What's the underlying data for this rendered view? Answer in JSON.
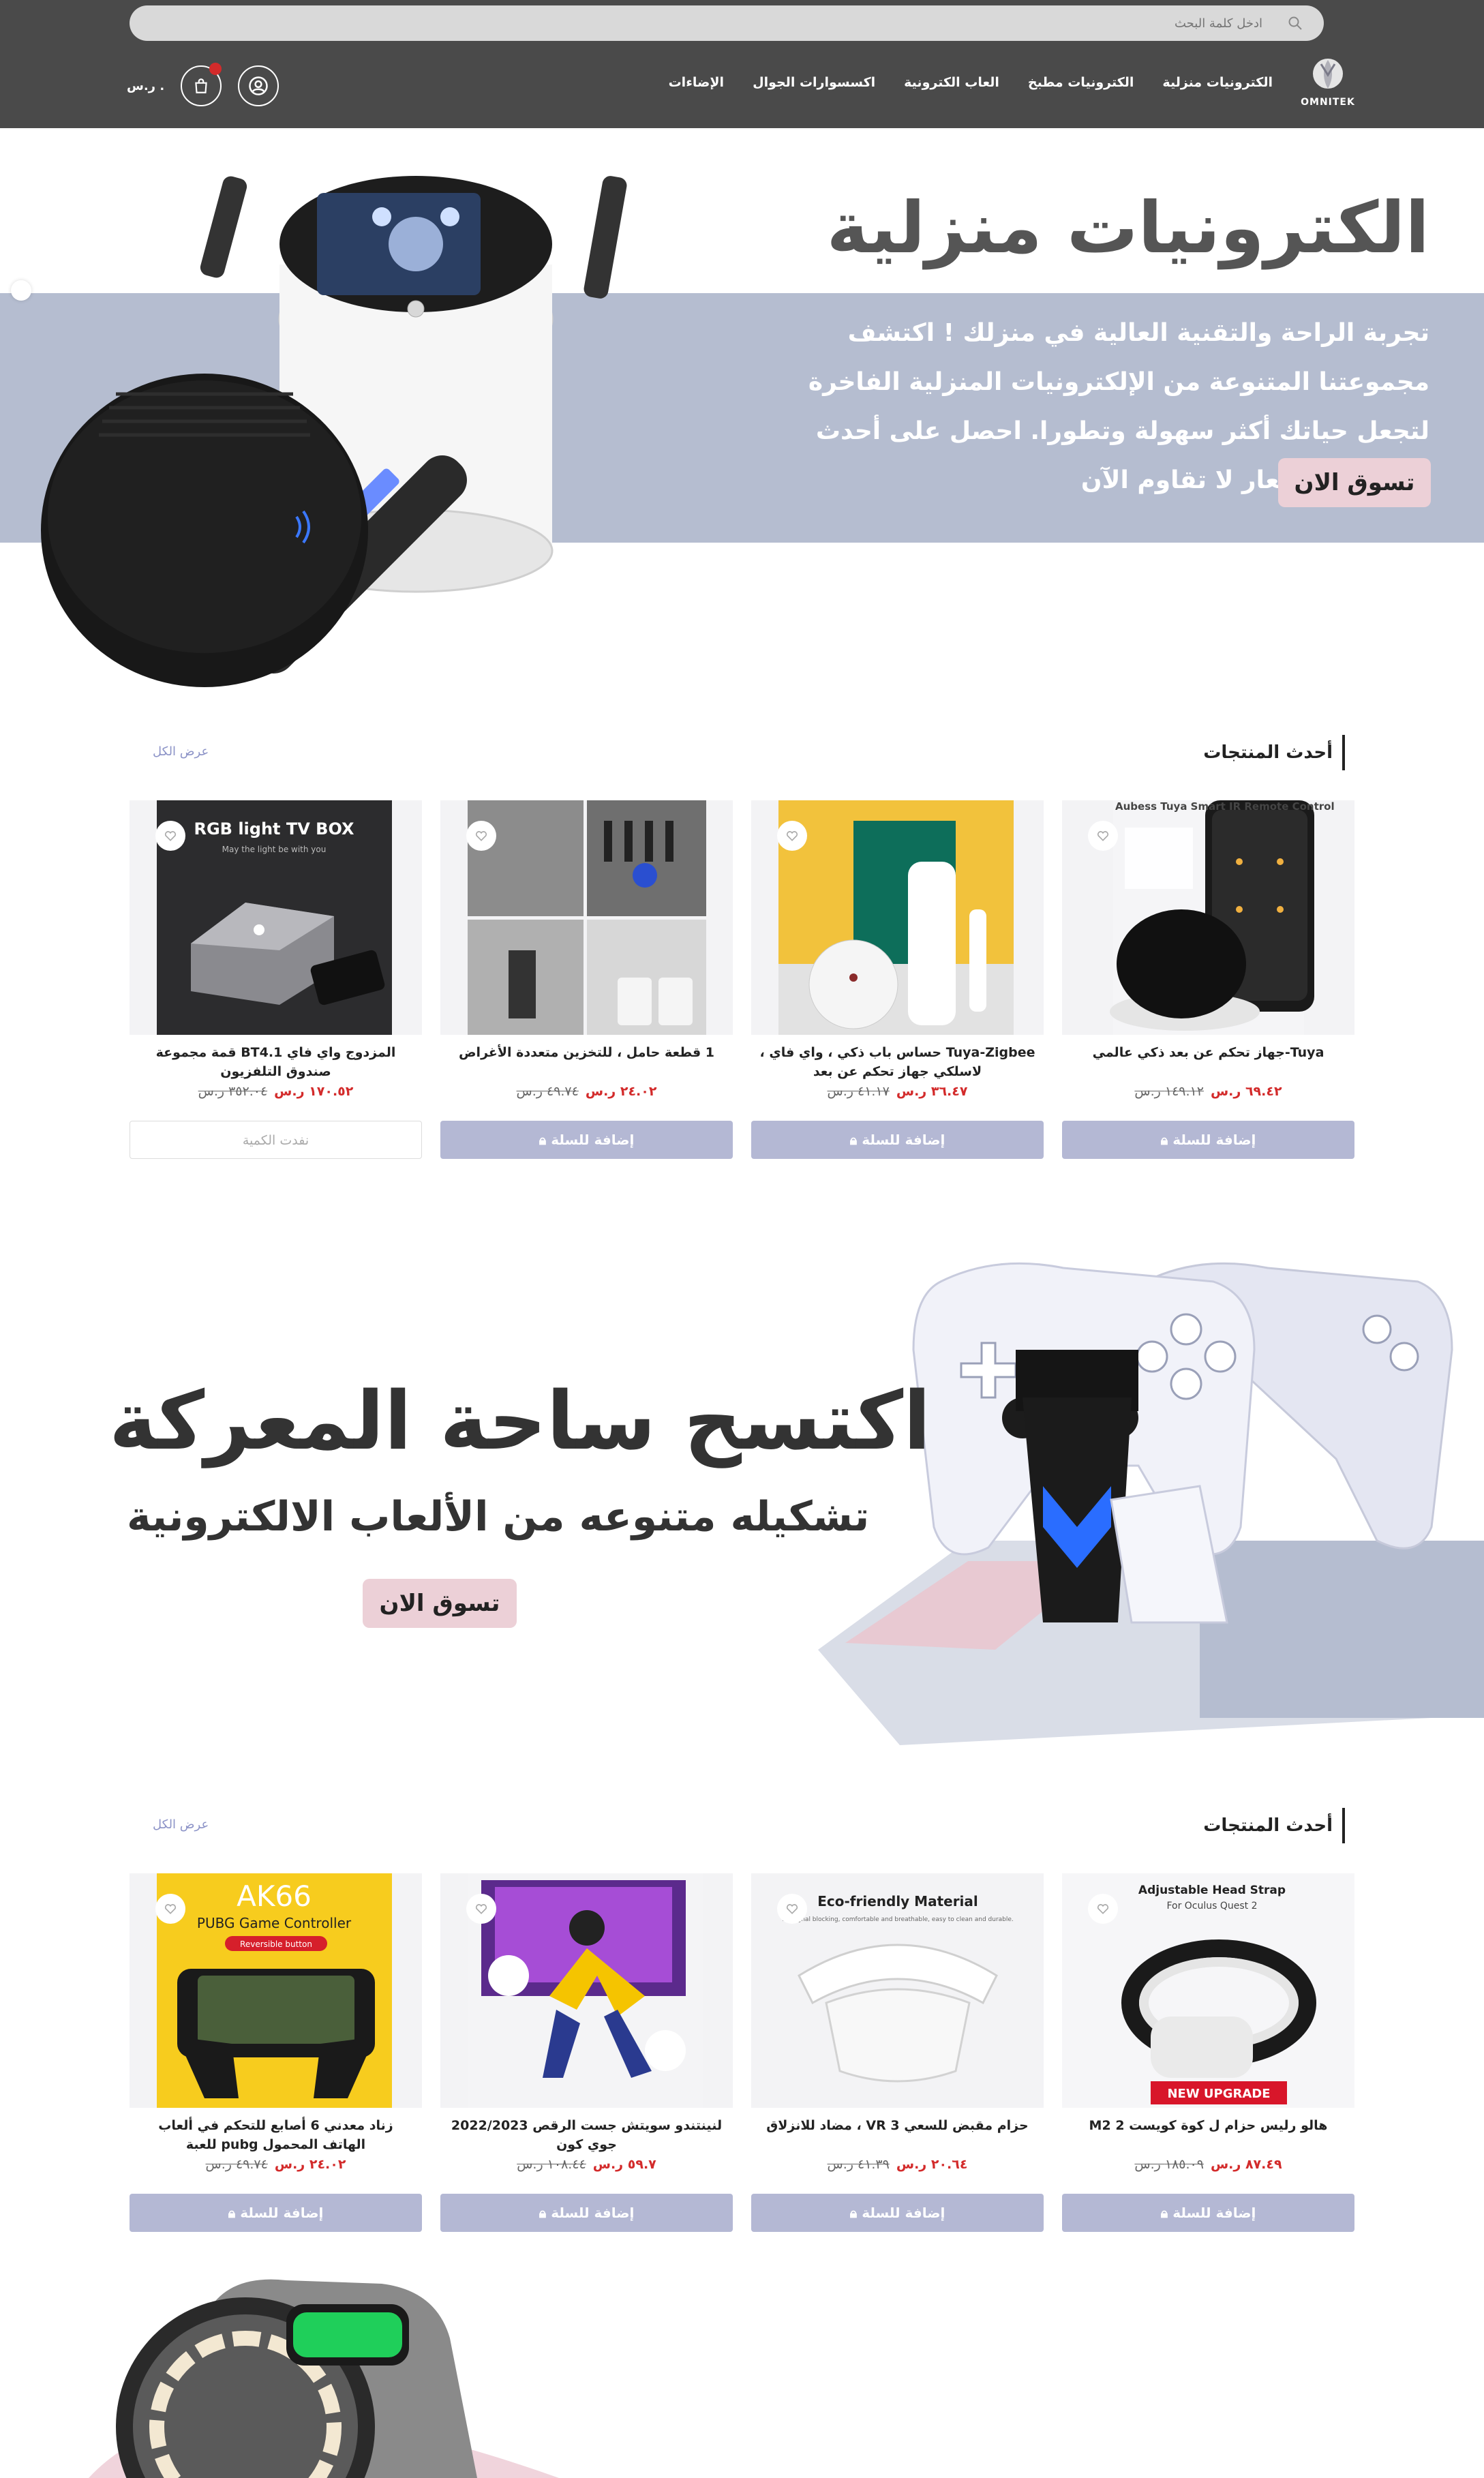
{
  "header": {
    "search_placeholder": "ادخل كلمة البحث",
    "logo_text": "OMNITEK",
    "nav": [
      "الكترونيات منزلية",
      "الكترونيات مطبخ",
      "العاب الكترونية",
      "اكسسوارات الجوال",
      "الإضاءات"
    ],
    "currency": "ر.س ."
  },
  "hero1": {
    "title": "الكترونيات منزلية",
    "description": "تجربة الراحة والتقنية العالية في منزلك ! اكتشف مجموعتنا المتنوعة من الإلكترونيات المنزلية الفاخرة لتجعل حياتك أكثر سهولة وتطورا. احصل على أحدث التقنيات بأسعار لا تقاوم الآن",
    "button": "تسوق الان"
  },
  "section1": {
    "title": "أحدث المنتجات",
    "view_all": "عرض الكل",
    "products": [
      {
        "name": "Tuya-جهاز تحكم عن بعد ذكي عالمي",
        "price": "٦٩.٤٢ ر.س",
        "old_price": "١٤٩.١٢ ر.س",
        "button": "إضافة للسلة",
        "image_text": "Aubess Tuya Smart IR Remote Control"
      },
      {
        "name": "Tuya-Zigbee حساس باب ذكي ، واي فاي ، لاسلكي جهاز تحكم عن بعد",
        "price": "٣٦.٤٧ ر.س",
        "old_price": "٤١.١٧ ر.س",
        "button": "إضافة للسلة",
        "image_text": ""
      },
      {
        "name": "1 قطعة حامل ، للتخزين متعددة الأغراض",
        "price": "٢٤.٠٢ ر.س",
        "old_price": "٤٩.٧٤ ر.س",
        "button": "إضافة للسلة",
        "image_text": ""
      },
      {
        "name": "المزدوج واي فاي BT4.1 قمة مجموعة صندوق التلفزيون",
        "price": "١٧٠.٥٢ ر.س",
        "old_price": "٣٥٢.٠٤ ر.س",
        "button": "نفدت الكمية",
        "image_text": "RGB light TV BOX",
        "image_subtext": "May the light be with you"
      }
    ]
  },
  "hero2": {
    "title": "اكتسح ساحة المعركة",
    "subtitle": "تشكيله متنوعه من الألعاب الالكترونية",
    "button": "تسوق الان"
  },
  "section2": {
    "title": "أحدث المنتجات",
    "view_all": "عرض الكل",
    "products": [
      {
        "name": "هالو رليس حزام ل كوة كويست 2 M2",
        "price": "٨٧.٤٩ ر.س",
        "old_price": "١٨٥.٠٩ ر.س",
        "button": "إضافة للسلة",
        "image_text": "Adjustable Head Strap",
        "image_subtext": "For Oculus Quest 2",
        "badge": "NEW UPGRADE"
      },
      {
        "name": "حزام مقبض للسعي 3 VR ، مضاد للانزلاق",
        "price": "٢٠.٦٤ ر.س",
        "old_price": "٤١.٣٩ ر.س",
        "button": "إضافة للسلة",
        "image_text": "Eco-friendly Material",
        "image_subtext": "No signal blocking, comfortable and breathable, easy to clean and durable."
      },
      {
        "name": "لنينتندو سويتش جست الرقص 2022/2023 جوي كون",
        "price": "٥٩.٧ ر.س",
        "old_price": "١٠٨.٤٤ ر.س",
        "button": "إضافة للسلة",
        "image_text": ""
      },
      {
        "name": "زناد معدني 6 أصابع للتحكم في ألعاب الهاتف المحمول pubg للعبة",
        "price": "٢٤.٠٢ ر.س",
        "old_price": "٤٩.٧٤ ر.س",
        "button": "إضافة للسلة",
        "image_text": "AK66",
        "image_subtext": "PUBG Game Controller",
        "badge": "Reversible button"
      }
    ]
  },
  "colors": {
    "header_bg": "#4a4a4a",
    "band": "#b5bdd0",
    "pink_button": "#ecd0d7",
    "add_button": "#b4b8d4",
    "price_red": "#d32b2b",
    "link": "#8c93c7"
  }
}
